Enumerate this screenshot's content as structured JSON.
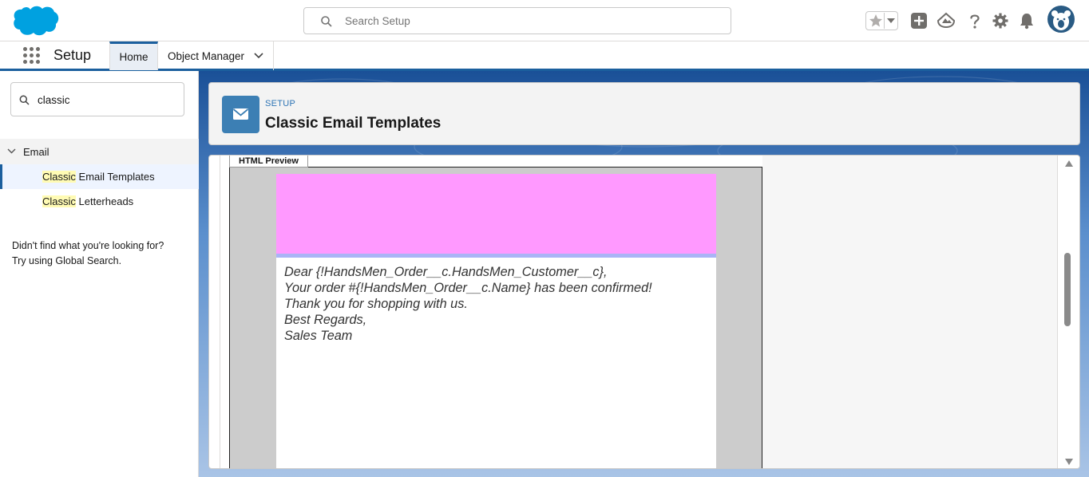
{
  "header": {
    "search_placeholder": "Search Setup",
    "icons": [
      "favorites-star-icon",
      "favorites-dropdown-icon",
      "global-actions-add-icon",
      "trailhead-icon",
      "help-icon",
      "setup-gear-icon",
      "notifications-bell-icon",
      "user-avatar"
    ]
  },
  "context_bar": {
    "app_name": "Setup",
    "tabs": [
      {
        "label": "Home",
        "active": true
      },
      {
        "label": "Object Manager",
        "active": false
      }
    ]
  },
  "sidebar": {
    "quick_find_value": "classic",
    "tree": {
      "section": "Email",
      "items": [
        {
          "highlight": "Classic",
          "rest": " Email Templates",
          "selected": true
        },
        {
          "highlight": "Classic",
          "rest": " Letterheads",
          "selected": false
        }
      ]
    },
    "help_line1": "Didn't find what you're looking for?",
    "help_line2": "Try using Global Search."
  },
  "page_header": {
    "eyebrow": "SETUP",
    "title": "Classic Email Templates"
  },
  "preview": {
    "tab_label": "HTML Preview",
    "header_color": "#ff99ff",
    "rule_color": "#aab4f6",
    "body_lines": [
      "Dear {!HandsMen_Order__c.HandsMen_Customer__c},",
      "Your order #{!HandsMen_Order__c.Name} has been confirmed!",
      "Thank you for shopping with us.",
      "Best Regards,",
      "Sales Team"
    ]
  },
  "colors": {
    "brand_blue": "#1b5f9e",
    "salesforce_cloud": "#00a1e0",
    "highlight": "#fffbb4"
  }
}
